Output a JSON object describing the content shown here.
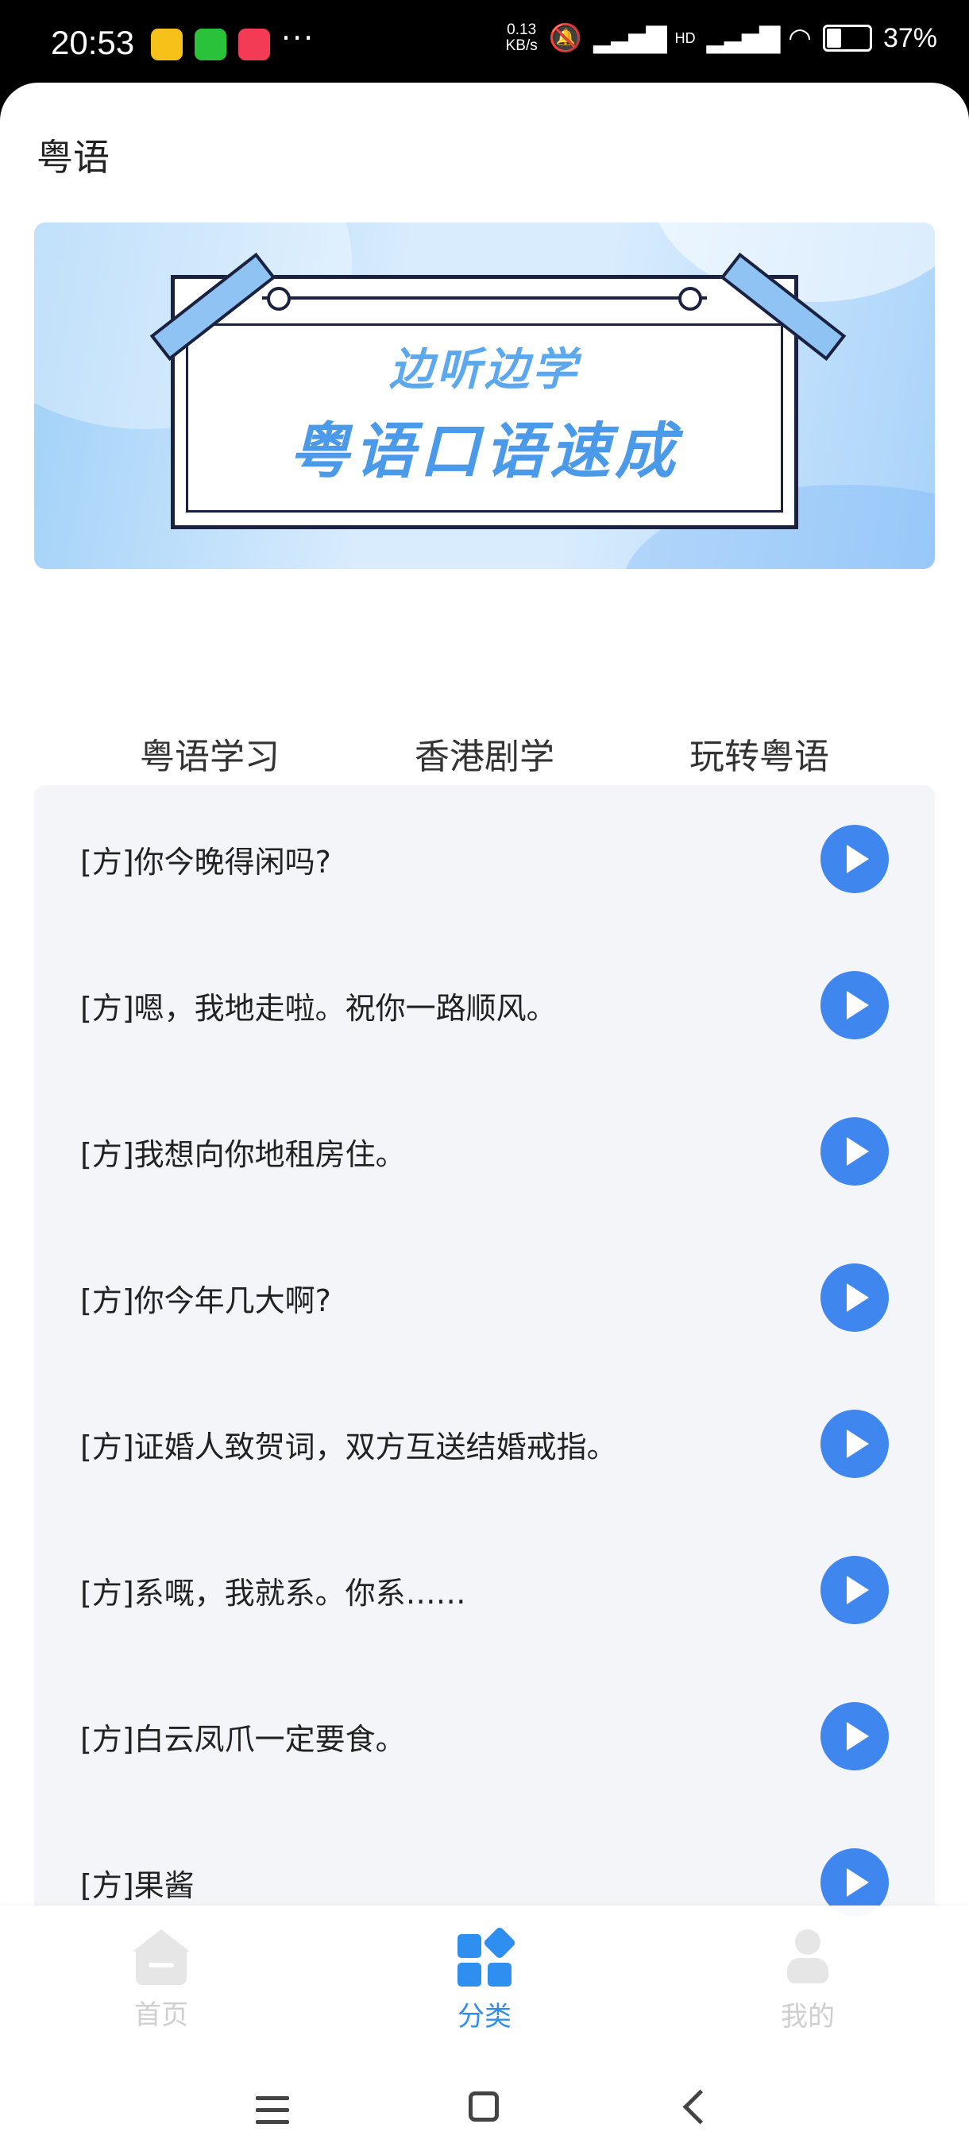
{
  "status_bar": {
    "time": "20:53",
    "network_speed_value": "0.13",
    "network_speed_unit": "KB/s",
    "signal_label": "HD",
    "battery": "37%",
    "more": "···"
  },
  "header": {
    "title": "粤语"
  },
  "banner": {
    "line1": "边听边学",
    "line2": "粤语口语速成"
  },
  "tabs": [
    {
      "label": "粤语学习",
      "active": true
    },
    {
      "label": "香港剧学",
      "active": false
    },
    {
      "label": "玩转粤语",
      "active": false
    }
  ],
  "phrases": [
    "[方]你今晚得闲吗?",
    "[方]嗯，我地走啦。祝你一路顺风。",
    "[方]我想向你地租房住。",
    "[方]你今年几大啊?",
    "[方]证婚人致贺词，双方互送结婚戒指。",
    "[方]系嘅，我就系。你系……",
    "[方]白云凤爪一定要食。",
    "[方]果酱"
  ],
  "bottom_nav": [
    {
      "label": "首页",
      "icon": "home-icon",
      "active": false
    },
    {
      "label": "分类",
      "icon": "category-grid-icon",
      "active": true
    },
    {
      "label": "我的",
      "icon": "user-icon",
      "active": false
    }
  ],
  "colors": {
    "accent": "#3f87ee",
    "nav_active": "#2f8ff0",
    "list_bg": "#f4f5f9"
  }
}
